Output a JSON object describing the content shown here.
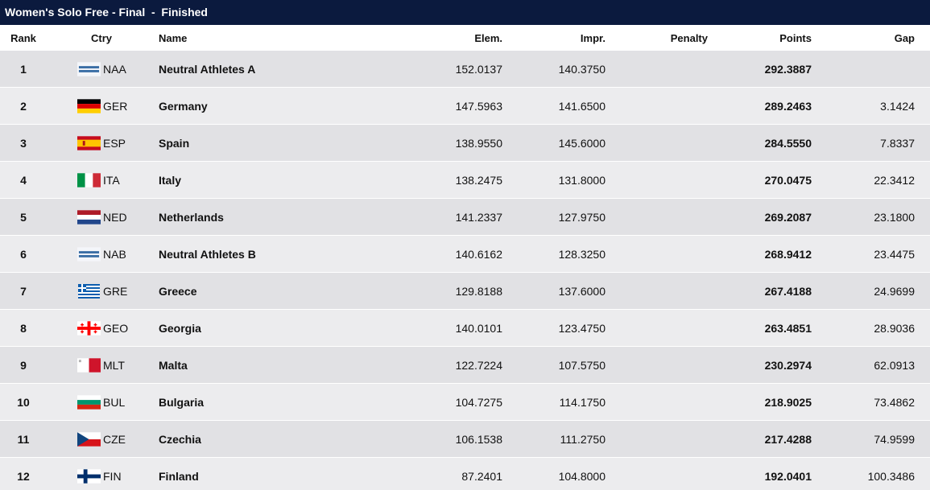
{
  "title": "Women's Solo Free - Final  -  Finished",
  "columns": {
    "rank": "Rank",
    "ctry": "Ctry",
    "name": "Name",
    "elem": "Elem.",
    "impr": "Impr.",
    "penalty": "Penalty",
    "points": "Points",
    "gap": "Gap"
  },
  "rows": [
    {
      "rank": "1",
      "code": "NAA",
      "flag": "european-aquatics-logo",
      "name": "Neutral Athletes A",
      "elem": "152.0137",
      "impr": "140.3750",
      "penalty": "",
      "points": "292.3887",
      "gap": ""
    },
    {
      "rank": "2",
      "code": "GER",
      "flag": "germany-flag",
      "name": "Germany",
      "elem": "147.5963",
      "impr": "141.6500",
      "penalty": "",
      "points": "289.2463",
      "gap": "3.1424"
    },
    {
      "rank": "3",
      "code": "ESP",
      "flag": "spain-flag",
      "name": "Spain",
      "elem": "138.9550",
      "impr": "145.6000",
      "penalty": "",
      "points": "284.5550",
      "gap": "7.8337"
    },
    {
      "rank": "4",
      "code": "ITA",
      "flag": "italy-flag",
      "name": "Italy",
      "elem": "138.2475",
      "impr": "131.8000",
      "penalty": "",
      "points": "270.0475",
      "gap": "22.3412"
    },
    {
      "rank": "5",
      "code": "NED",
      "flag": "netherlands-flag",
      "name": "Netherlands",
      "elem": "141.2337",
      "impr": "127.9750",
      "penalty": "",
      "points": "269.2087",
      "gap": "23.1800"
    },
    {
      "rank": "6",
      "code": "NAB",
      "flag": "european-aquatics-logo",
      "name": "Neutral Athletes B",
      "elem": "140.6162",
      "impr": "128.3250",
      "penalty": "",
      "points": "268.9412",
      "gap": "23.4475"
    },
    {
      "rank": "7",
      "code": "GRE",
      "flag": "greece-flag",
      "name": "Greece",
      "elem": "129.8188",
      "impr": "137.6000",
      "penalty": "",
      "points": "267.4188",
      "gap": "24.9699"
    },
    {
      "rank": "8",
      "code": "GEO",
      "flag": "georgia-flag",
      "name": "Georgia",
      "elem": "140.0101",
      "impr": "123.4750",
      "penalty": "",
      "points": "263.4851",
      "gap": "28.9036"
    },
    {
      "rank": "9",
      "code": "MLT",
      "flag": "malta-flag",
      "name": "Malta",
      "elem": "122.7224",
      "impr": "107.5750",
      "penalty": "",
      "points": "230.2974",
      "gap": "62.0913"
    },
    {
      "rank": "10",
      "code": "BUL",
      "flag": "bulgaria-flag",
      "name": "Bulgaria",
      "elem": "104.7275",
      "impr": "114.1750",
      "penalty": "",
      "points": "218.9025",
      "gap": "73.4862"
    },
    {
      "rank": "11",
      "code": "CZE",
      "flag": "czechia-flag",
      "name": "Czechia",
      "elem": "106.1538",
      "impr": "111.2750",
      "penalty": "",
      "points": "217.4288",
      "gap": "74.9599"
    },
    {
      "rank": "12",
      "code": "FIN",
      "flag": "finland-flag",
      "name": "Finland",
      "elem": "87.2401",
      "impr": "104.8000",
      "penalty": "",
      "points": "192.0401",
      "gap": "100.3486"
    }
  ],
  "colors": {
    "header_bg": "#0b1a3e",
    "row_odd": "#e1e1e4",
    "row_even": "#ececee"
  }
}
